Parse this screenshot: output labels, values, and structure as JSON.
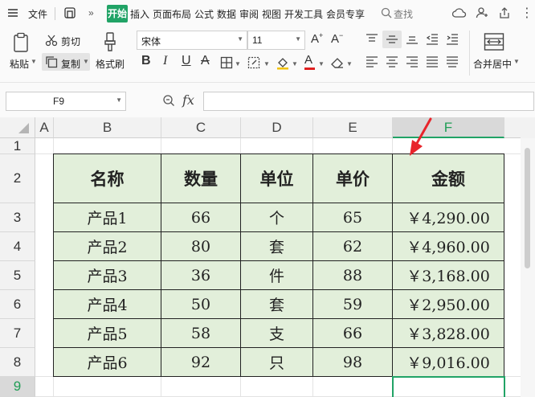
{
  "menu": {
    "file": "文件",
    "tabs": [
      "开始",
      "插入",
      "页面布局",
      "公式",
      "数据",
      "审阅",
      "视图",
      "开发工具",
      "会员专享"
    ],
    "search": "查找"
  },
  "ribbon": {
    "paste": "粘贴",
    "cut": "剪切",
    "copy": "复制",
    "format_painter": "格式刷",
    "font_name": "宋体",
    "font_size": "11",
    "merge_center": "合并居中"
  },
  "formula_bar": {
    "cell_ref": "F9",
    "fx": "fx",
    "content": ""
  },
  "sheet": {
    "columns": [
      "A",
      "B",
      "C",
      "D",
      "E",
      "F"
    ],
    "rows": [
      "1",
      "2",
      "3",
      "4",
      "5",
      "6",
      "7",
      "8",
      "9"
    ],
    "selected_cell": "F9",
    "header": [
      "名称",
      "数量",
      "单位",
      "单价",
      "金额"
    ],
    "data": [
      [
        "产品1",
        "66",
        "个",
        "65",
        "￥4,290.00"
      ],
      [
        "产品2",
        "80",
        "套",
        "62",
        "￥4,960.00"
      ],
      [
        "产品3",
        "36",
        "件",
        "88",
        "￥3,168.00"
      ],
      [
        "产品4",
        "50",
        "套",
        "59",
        "￥2,950.00"
      ],
      [
        "产品5",
        "58",
        "支",
        "66",
        "￥3,828.00"
      ],
      [
        "产品6",
        "92",
        "只",
        "98",
        "￥9,016.00"
      ]
    ]
  },
  "colors": {
    "accent": "#21a366",
    "table_fill": "#e2efda",
    "arrow": "#e8242b"
  }
}
